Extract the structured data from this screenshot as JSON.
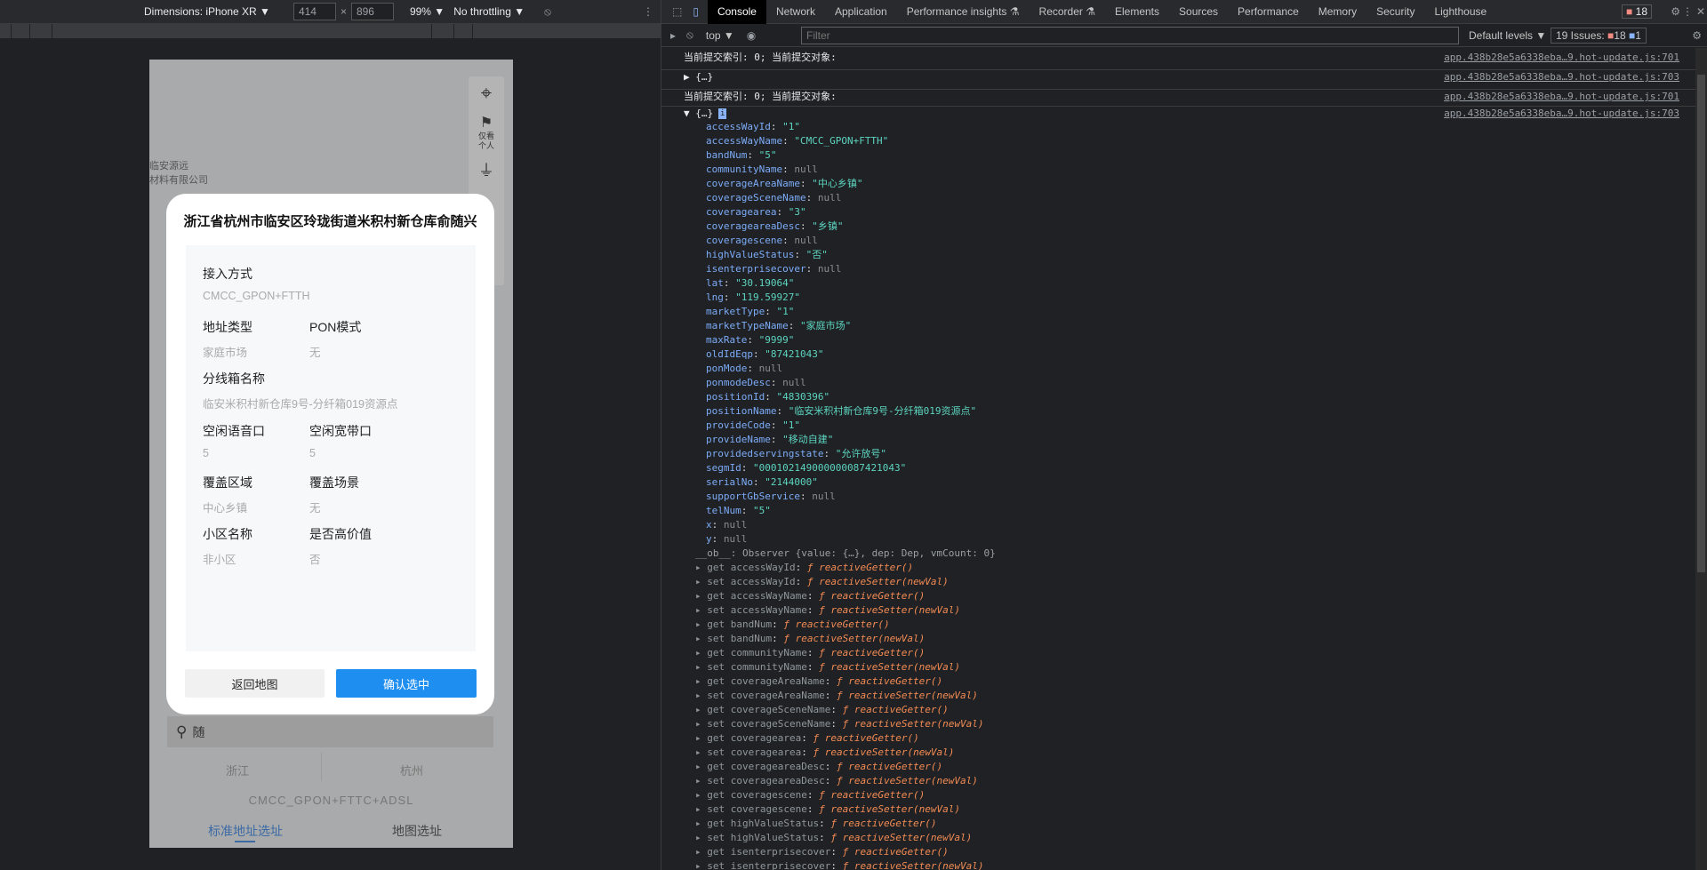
{
  "device_toolbar": {
    "dimensions": "Dimensions: iPhone XR ▼",
    "width": "414",
    "height": "896",
    "x": "×",
    "zoom": "99% ▼",
    "throttling": "No throttling ▼",
    "rotate_icon": "rotate-icon",
    "more_icon": "⋮"
  },
  "phone": {
    "map_labels": [
      "临安源远",
      "材料有限公司"
    ],
    "map_tools": [
      "仅看",
      "个人"
    ],
    "modal": {
      "title": "浙江省杭州市临安区玲珑街道米积村新仓库俞随兴",
      "fields": [
        {
          "label": "接入方式",
          "value": "CMCC_GPON+FTTH"
        },
        {
          "label": "地址类型",
          "value": "家庭市场"
        },
        {
          "label": "PON模式",
          "value": "无"
        },
        {
          "label": "分线箱名称",
          "value": "临安米积村新仓库9号-分纤箱019资源点"
        },
        {
          "label": "空闲语音口",
          "value": "5"
        },
        {
          "label": "空闲宽带口",
          "value": "5"
        },
        {
          "label": "覆盖区域",
          "value": "中心乡镇"
        },
        {
          "label": "覆盖场景",
          "value": "无"
        },
        {
          "label": "小区名称",
          "value": "非小区"
        },
        {
          "label": "是否高价值",
          "value": "否"
        }
      ],
      "back_button": "返回地图",
      "confirm_button": "确认选中"
    },
    "search_value": "随",
    "region_tabs": [
      "浙江",
      "杭州"
    ],
    "access_text": "CMCC_GPON+FTTC+ADSL",
    "bottom_tabs": [
      "标准地址选址",
      "地图选址"
    ]
  },
  "devtools": {
    "tabs": [
      "Console",
      "Network",
      "Application",
      "Performance insights ⚗",
      "Recorder ⚗",
      "Elements",
      "Sources",
      "Performance",
      "Memory",
      "Security",
      "Lighthouse"
    ],
    "error_count": "18",
    "context": "top ▼",
    "filter_placeholder": "Filter",
    "levels": "Default levels ▼",
    "issues": {
      "label": "19 Issues:",
      "errors": "18",
      "info": "1"
    },
    "accent": "#1a73e8",
    "logs": [
      {
        "text": "当前提交索引: 0;  当前提交对象:",
        "source": "app.438b28e5a6338eba…9.hot-update.js:701"
      },
      {
        "text": "▶ {…}",
        "source": "app.438b28e5a6338eba…9.hot-update.js:703"
      },
      {
        "text": "当前提交索引: 0;  当前提交对象:",
        "source": "app.438b28e5a6338eba…9.hot-update.js:701"
      },
      {
        "text": "▼ {…}",
        "source": "app.438b28e5a6338eba…9.hot-update.js:703"
      }
    ],
    "properties": [
      [
        "accessWayId",
        "\"1\"",
        "s"
      ],
      [
        "accessWayName",
        "\"CMCC_GPON+FTTH\"",
        "s"
      ],
      [
        "bandNum",
        "\"5\"",
        "s"
      ],
      [
        "communityName",
        "null",
        "n"
      ],
      [
        "coverageAreaName",
        "\"中心乡镇\"",
        "s"
      ],
      [
        "coverageSceneName",
        "null",
        "n"
      ],
      [
        "coveragearea",
        "\"3\"",
        "s"
      ],
      [
        "coverageareaDesc",
        "\"乡镇\"",
        "s"
      ],
      [
        "coveragescene",
        "null",
        "n"
      ],
      [
        "highValueStatus",
        "\"否\"",
        "s"
      ],
      [
        "isenterprisecover",
        "null",
        "n"
      ],
      [
        "lat",
        "\"30.19064\"",
        "s"
      ],
      [
        "lng",
        "\"119.59927\"",
        "s"
      ],
      [
        "marketType",
        "\"1\"",
        "s"
      ],
      [
        "marketTypeName",
        "\"家庭市场\"",
        "s"
      ],
      [
        "maxRate",
        "\"9999\"",
        "s"
      ],
      [
        "oldIdEqp",
        "\"87421043\"",
        "s"
      ],
      [
        "ponMode",
        "null",
        "n"
      ],
      [
        "ponmodeDesc",
        "null",
        "n"
      ],
      [
        "positionId",
        "\"4830396\"",
        "s"
      ],
      [
        "positionName",
        "\"临安米积村新仓库9号-分纤箱019资源点\"",
        "s"
      ],
      [
        "provideCode",
        "\"1\"",
        "s"
      ],
      [
        "provideName",
        "\"移动自建\"",
        "s"
      ],
      [
        "providedservingstate",
        "\"允许放号\"",
        "s"
      ],
      [
        "segmId",
        "\"000102149000000087421043\"",
        "s"
      ],
      [
        "serialNo",
        "\"2144000\"",
        "s"
      ],
      [
        "supportGbService",
        "null",
        "n"
      ],
      [
        "telNum",
        "\"5\"",
        "s"
      ],
      [
        "x",
        "null",
        "n"
      ],
      [
        "y",
        "null",
        "n"
      ]
    ],
    "observer": "__ob__: Observer {value: {…}, dep: Dep, vmCount: 0}",
    "accessor_keys": [
      "accessWayId",
      "accessWayName",
      "bandNum",
      "communityName",
      "coverageAreaName",
      "coverageSceneName",
      "coveragearea",
      "coverageareaDesc",
      "coveragescene",
      "highValueStatus",
      "isenterprisecover"
    ],
    "getter": "ƒ reactiveGetter()",
    "setter": "ƒ reactiveSetter(newVal)"
  }
}
